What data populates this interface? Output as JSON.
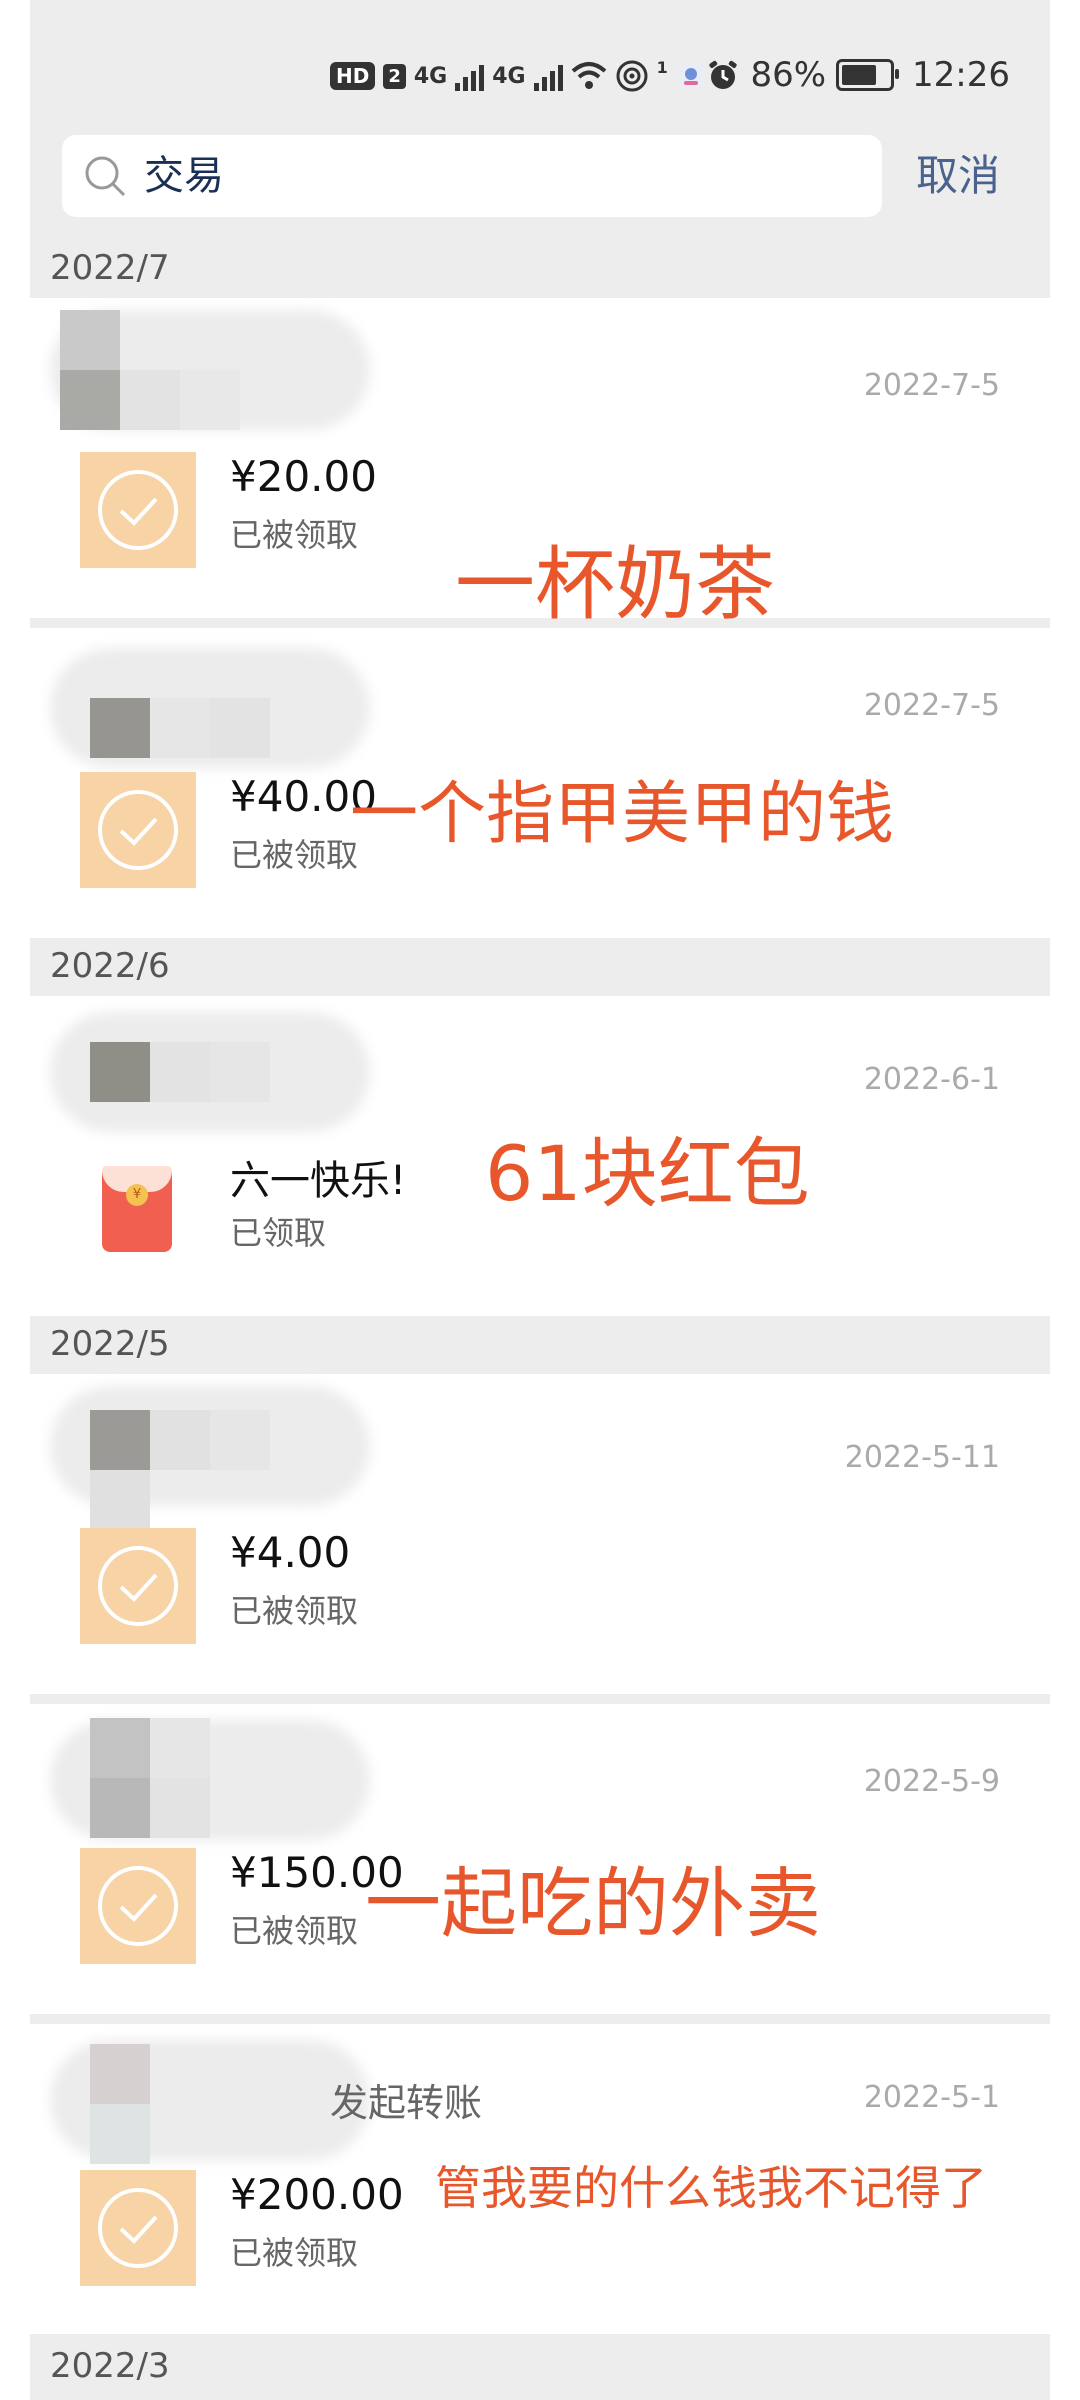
{
  "status_bar": {
    "hd": "HD",
    "sim": "2",
    "net1": "4G",
    "net2": "4G",
    "wifi_sup": "1",
    "battery_pct": "86%",
    "battery_level": 0.86,
    "time": "12:26"
  },
  "search": {
    "query": "交易",
    "cancel_label": "取消"
  },
  "months": [
    "2022/7",
    "2022/6",
    "2022/5",
    "2022/3"
  ],
  "transactions": [
    {
      "date": "2022-7-5",
      "amount": "¥20.00",
      "status": "已被领取",
      "note": "一杯奶茶"
    },
    {
      "date": "2022-7-5",
      "amount": "¥40.00",
      "status": "已被领取",
      "note": "一个指甲美甲的钱"
    },
    {
      "date": "2022-6-1",
      "title": "六一快乐!",
      "status": "已领取",
      "note": "61块红包",
      "icon": "red-packet-icon"
    },
    {
      "date": "2022-5-11",
      "amount": "¥4.00",
      "status": "已被领取"
    },
    {
      "date": "2022-5-9",
      "amount": "¥150.00",
      "status": "已被领取",
      "note": "一起吃的外卖"
    },
    {
      "date": "2022-5-1",
      "caption": "发起转账",
      "amount": "¥200.00",
      "status": "已被领取",
      "note": "管我要的什么钱我不记得了"
    }
  ],
  "colors": {
    "accent": "#4a628e",
    "annotation": "#e8572b",
    "check_bg": "#f7d3a6",
    "red_packet": "#f15f50"
  }
}
